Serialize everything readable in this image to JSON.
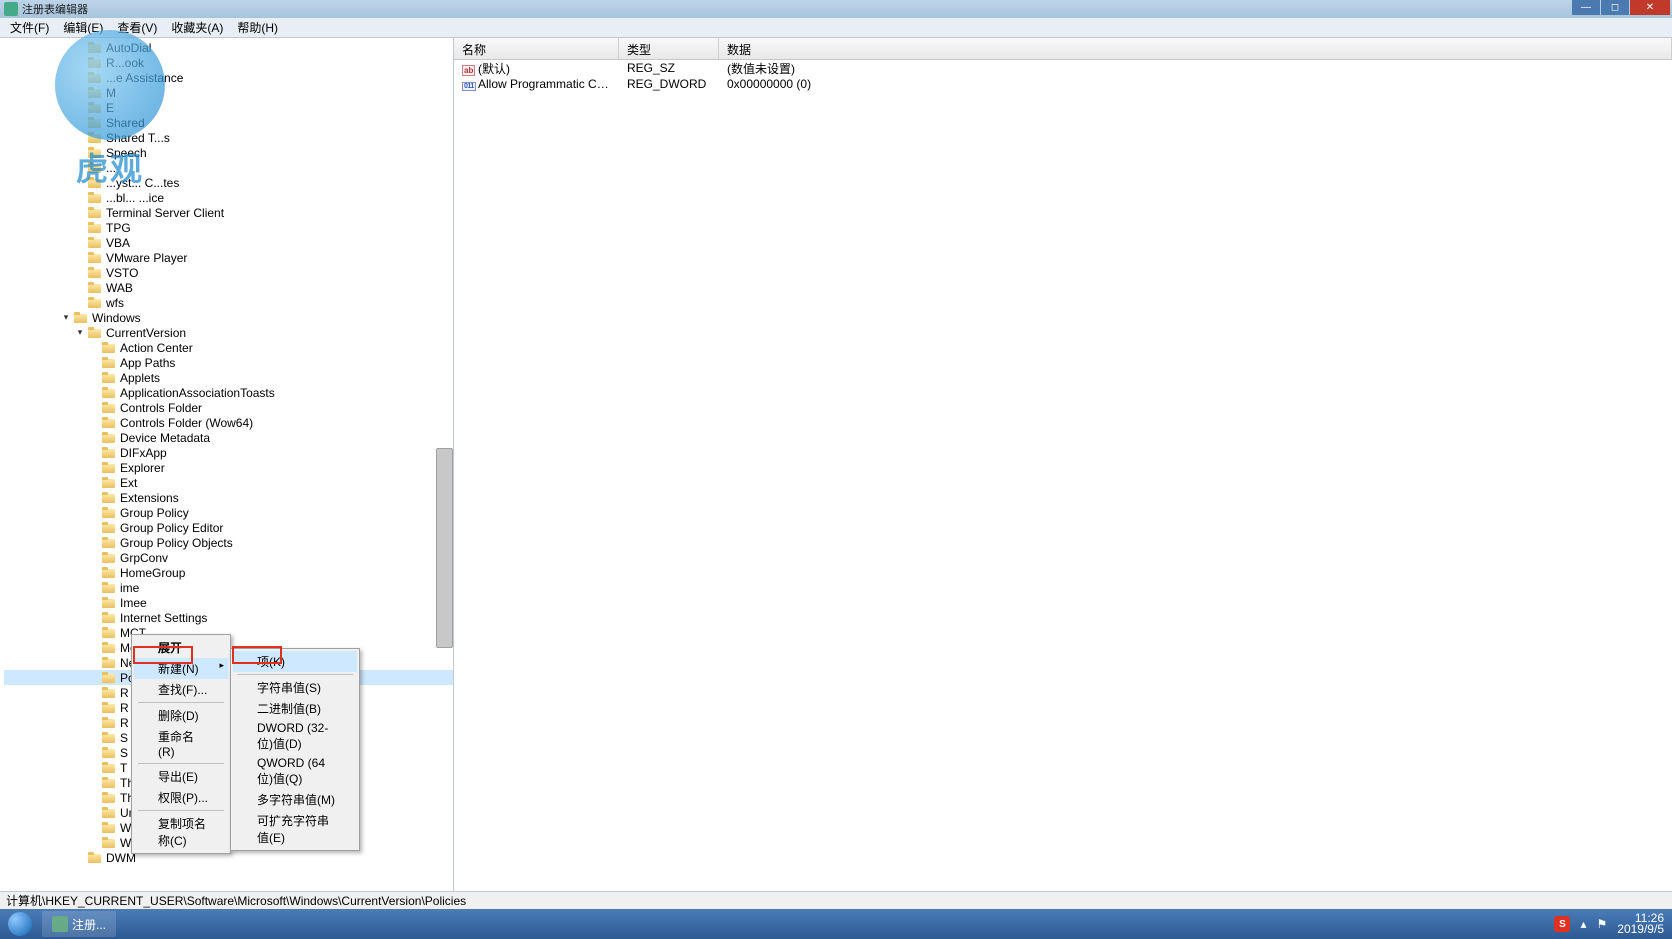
{
  "window": {
    "title": "注册表编辑器"
  },
  "menu": {
    "file": "文件(F)",
    "edit": "编辑(E)",
    "view": "查看(V)",
    "fav": "收藏夹(A)",
    "help": "帮助(H)"
  },
  "treeTop": [
    {
      "l": 5,
      "t": "",
      "x": "AutoDial",
      "hidden": true
    },
    {
      "l": 5,
      "t": "",
      "x": "R...ook",
      "partial": "Outlook"
    },
    {
      "l": 5,
      "t": "",
      "x": "...e Assistance",
      "partial": "Remote Assistance"
    },
    {
      "l": 5,
      "t": "",
      "x": "M"
    },
    {
      "l": 5,
      "t": "",
      "x": "E"
    },
    {
      "l": 5,
      "t": "",
      "x": "Shared"
    },
    {
      "l": 5,
      "t": "",
      "x": "Shared T...s"
    },
    {
      "l": 5,
      "t": "",
      "x": "Speech"
    },
    {
      "l": 5,
      "t": "",
      "x": "..."
    },
    {
      "l": 5,
      "t": "",
      "x": "...yst... C...tes"
    },
    {
      "l": 5,
      "t": "",
      "x": "...bl... ...ice"
    },
    {
      "l": 5,
      "t": "",
      "x": "Terminal Server Client"
    },
    {
      "l": 5,
      "t": "",
      "x": "TPG"
    },
    {
      "l": 5,
      "t": "",
      "x": "VBA"
    },
    {
      "l": 5,
      "t": "",
      "x": "VMware Player"
    },
    {
      "l": 5,
      "t": "",
      "x": "VSTO"
    },
    {
      "l": 5,
      "t": "",
      "x": "WAB"
    },
    {
      "l": 5,
      "t": "",
      "x": "wfs"
    }
  ],
  "windowsNode": "Windows",
  "cvNode": "CurrentVersion",
  "cvChildren": [
    "Action Center",
    "App Paths",
    "Applets",
    "ApplicationAssociationToasts",
    "Controls Folder",
    "Controls Folder (Wow64)",
    "Device Metadata",
    "DIFxApp",
    "Explorer",
    "Ext",
    "Extensions",
    "Group Policy",
    "Group Policy Editor",
    "Group Policy Objects",
    "GrpConv",
    "HomeGroup",
    "ime",
    "Imee",
    "Internet Settings",
    "MCT",
    "Media Center",
    "NetCache",
    "Policies"
  ],
  "cvChildrenBelow": [
    "R",
    "R",
    "R",
    "S",
    "S",
    "T"
  ],
  "cvChildrenAfter": [
    "ThemeManager",
    "Themes",
    "Uninstall",
    "Webcheck",
    "WinTrust"
  ],
  "dwmNode": "DWM",
  "listHeader": {
    "name": "名称",
    "type": "类型",
    "data": "数据"
  },
  "listRows": [
    {
      "icon": "sz",
      "name": "(默认)",
      "type": "REG_SZ",
      "data": "(数值未设置)"
    },
    {
      "icon": "dw",
      "name": "Allow Programmatic Cut_Co...",
      "type": "REG_DWORD",
      "data": "0x00000000 (0)"
    }
  ],
  "ctx1": {
    "expand": "展开",
    "new": "新建(N)",
    "find": "查找(F)...",
    "delete": "删除(D)",
    "rename": "重命名(R)",
    "export": "导出(E)",
    "perm": "权限(P)...",
    "copyname": "复制项名称(C)"
  },
  "ctx2": {
    "key": "项(K)",
    "string": "字符串值(S)",
    "binary": "二进制值(B)",
    "dword": "DWORD (32-位)值(D)",
    "qword": "QWORD (64 位)值(Q)",
    "multi": "多字符串值(M)",
    "expand": "可扩充字符串值(E)"
  },
  "status": "计算机\\HKEY_CURRENT_USER\\Software\\Microsoft\\Windows\\CurrentVersion\\Policies",
  "taskbar": {
    "app": "注册...",
    "time": "11:26",
    "date": "2019/9/5"
  },
  "watermark": "虎观"
}
